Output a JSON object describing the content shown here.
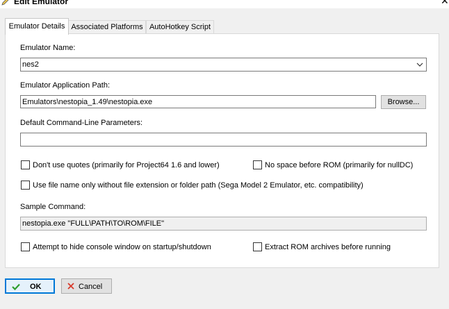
{
  "window": {
    "title": "Edit Emulator",
    "close_glyph": "✕"
  },
  "tabs": [
    {
      "label": "Emulator Details",
      "active": true
    },
    {
      "label": "Associated Platforms",
      "active": false
    },
    {
      "label": "AutoHotkey Script",
      "active": false
    }
  ],
  "form": {
    "emulator_name_label": "Emulator Name:",
    "emulator_name_value": "nes2",
    "app_path_label": "Emulator Application Path:",
    "app_path_value": "Emulators\\nestopia_1.49\\nestopia.exe",
    "browse_label": "Browse...",
    "cmdline_label": "Default Command-Line Parameters:",
    "cmdline_value": "",
    "chk_no_quotes": "Don't use quotes (primarily for Project64 1.6 and lower)",
    "chk_no_space": "No space before ROM (primarily for nullDC)",
    "chk_filename_only": "Use file name only without file extension or folder path (Sega Model 2 Emulator, etc. compatibility)",
    "sample_label": "Sample Command:",
    "sample_value": "nestopia.exe \"FULL\\PATH\\TO\\ROM\\FILE\"",
    "chk_hide_console": "Attempt to hide console window on startup/shutdown",
    "chk_extract": "Extract ROM archives before running"
  },
  "buttons": {
    "ok": "OK",
    "cancel": "Cancel"
  },
  "colors": {
    "ok_check": "#2e9e2e",
    "cancel_x": "#d93a2b",
    "ok_border": "#0078d7"
  }
}
